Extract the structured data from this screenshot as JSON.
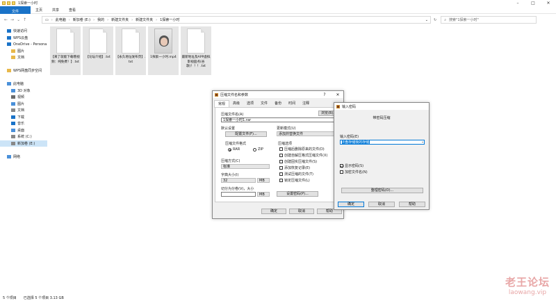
{
  "explorer": {
    "title": "1探索一小时",
    "ribbon_tabs": [
      "文件",
      "主页",
      "共享",
      "查看"
    ],
    "breadcrumb": [
      "此电脑",
      "新加卷 (E:)",
      "我的",
      "新建文件夹",
      "新建文件夹",
      "1探索一小时"
    ],
    "search_placeholder": "搜索\"1探索一小时\"",
    "sidebar": [
      {
        "label": "快速访问",
        "indent": false
      },
      {
        "label": "WPS云盘",
        "indent": false
      },
      {
        "label": "OneDrive - Persona",
        "indent": false
      },
      {
        "label": "图片",
        "indent": true
      },
      {
        "label": "文档",
        "indent": true
      },
      {
        "label": "",
        "indent": false
      },
      {
        "label": "WPS网盘同步空间",
        "indent": false
      },
      {
        "label": "",
        "indent": false
      },
      {
        "label": "此电脑",
        "indent": false
      },
      {
        "label": "3D 对象",
        "indent": true
      },
      {
        "label": "视频",
        "indent": true
      },
      {
        "label": "图片",
        "indent": true
      },
      {
        "label": "文档",
        "indent": true
      },
      {
        "label": "下载",
        "indent": true
      },
      {
        "label": "音乐",
        "indent": true
      },
      {
        "label": "桌面",
        "indent": true
      },
      {
        "label": "系统 (C:)",
        "indent": true
      },
      {
        "label": "新加卷 (E:)",
        "indent": true,
        "selected": true
      },
      {
        "label": "",
        "indent": false
      },
      {
        "label": "网络",
        "indent": false
      }
    ],
    "files": [
      {
        "name": "【来了就能下载哦视频：纯免费！】.txt",
        "kind": "doc"
      },
      {
        "name": "【论坛介绍】.txt",
        "kind": "doc"
      },
      {
        "name": "【永久地址发布页】.txt",
        "kind": "doc"
      },
      {
        "name": "1探索一小时.mp4",
        "kind": "video"
      },
      {
        "name": "最新地址及APP虚拟影视盘点(谷歌)！！！.txt",
        "kind": "doc"
      }
    ],
    "status": {
      "count": "5 个项目",
      "selected": "已选择 5 个项目  3.13 GB"
    }
  },
  "archive_dialog": {
    "title": "压缩文件名和参数",
    "help": "?",
    "close": "✕",
    "tabs": [
      "常规",
      "高级",
      "选项",
      "文件",
      "备份",
      "时间",
      "注释"
    ],
    "archive_name_label": "压缩文件名(A)",
    "browse_label": "浏览(B)...",
    "archive_name_value": "1探索一小时1.rar",
    "default_settings_label": "默认设置",
    "profiles_button": "配置文件(F)...",
    "update_mode_label": "更新模式(U)",
    "update_mode_value": "添加并替换文件",
    "format_label": "压缩文件格式",
    "format_options": [
      "RAR",
      "ZIP"
    ],
    "format_selected": "RAR",
    "method_label": "压缩方式(C)",
    "method_value": "标准",
    "dict_label": "字典大小(I)",
    "dict_value": "32",
    "dict_unit": "MB",
    "split_label": "切分为分卷(V)，大小",
    "split_unit": "MB",
    "options_label": "压缩选项",
    "options": [
      {
        "label": "压缩后删除原来的文件(D)",
        "checked": false
      },
      {
        "label": "创建自解压格式压缩文件(X)",
        "checked": false
      },
      {
        "label": "创建固实压缩文件(S)",
        "checked": false
      },
      {
        "label": "添加恢复记录(E)",
        "checked": false
      },
      {
        "label": "测试压缩的文件(T)",
        "checked": false
      },
      {
        "label": "锁定压缩文件(L)",
        "checked": false
      }
    ],
    "set_password_button": "设置密码(P)...",
    "ok": "确定",
    "cancel": "取消",
    "help_button": "帮助"
  },
  "password_dialog": {
    "title": "输入密码",
    "heading": "带密码压缩",
    "input_label": "输入密码(E)",
    "password_value": "E盘存储我的存储",
    "options": [
      {
        "label": "显示密码(S)",
        "checked": true
      },
      {
        "label": "加密文件名(N)",
        "checked": false
      }
    ],
    "manage_button": "整理密码(O)...",
    "ok": "确定",
    "cancel": "取消",
    "help": "帮助"
  },
  "watermark": {
    "line1": "老王论坛",
    "line2": "laowang.vip"
  },
  "colors": {
    "accent": "#0078d7",
    "file_tab": "#1a73c8",
    "selection": "#cce4f7",
    "watermark": "#e8a6a6"
  }
}
